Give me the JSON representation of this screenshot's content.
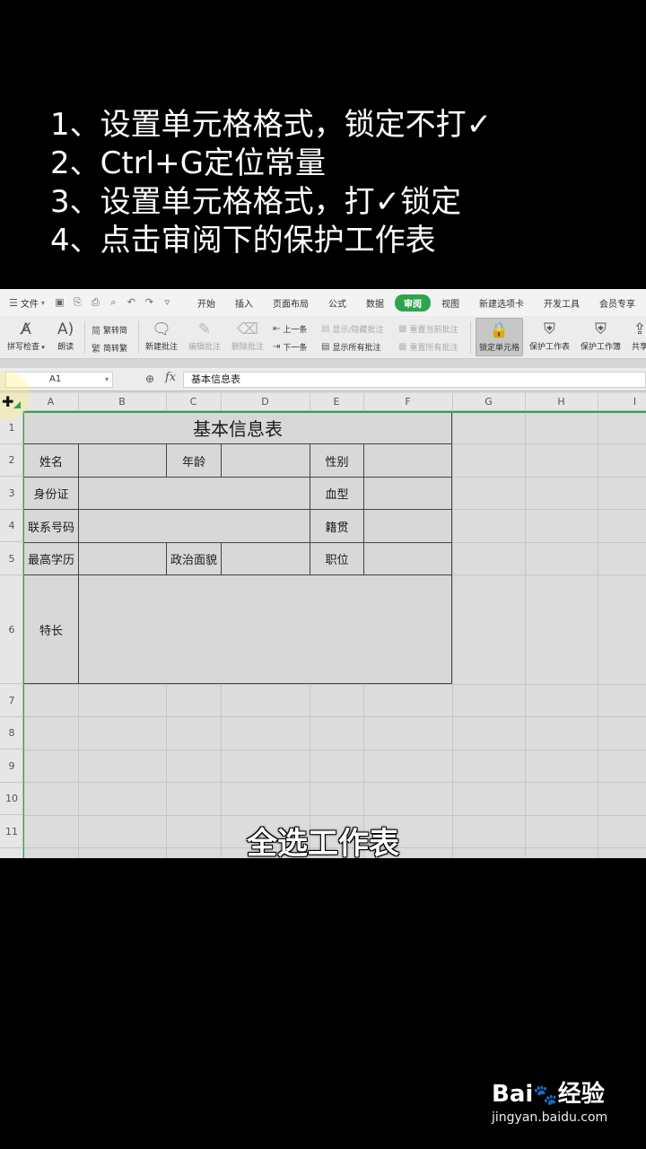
{
  "instructions": [
    "1、设置单元格格式，锁定不打✓",
    "2、Ctrl+G定位常量",
    "3、设置单元格格式，打✓锁定",
    "4、点击审阅下的保护工作表"
  ],
  "menubar": {
    "file_label": "文件",
    "tabs": [
      "开始",
      "插入",
      "页面布局",
      "公式",
      "数据",
      "审阅",
      "视图",
      "新建选项卡",
      "开发工具",
      "会员专享"
    ],
    "active_tab": "审阅"
  },
  "ribbon": {
    "spell_check": "拼写检查",
    "read_aloud": "朗读",
    "trad_to_simp": "繁转简",
    "simp_to_trad": "简转繁",
    "new_comment": "新建批注",
    "edit_comment": "编辑批注",
    "delete_comment": "删除批注",
    "prev_comment": "上一条",
    "next_comment": "下一条",
    "show_hide_comment": "显示/隐藏批注",
    "show_all_comments": "显示所有批注",
    "reset_current_comment": "重置当前批注",
    "reset_all_comments": "重置所有批注",
    "lock_cell": "锁定单元格",
    "protect_sheet": "保护工作表",
    "protect_workbook": "保护工作簿",
    "share": "共享"
  },
  "formula_bar": {
    "name_box": "A1",
    "fx_label": "fx",
    "content": "基本信息表"
  },
  "sheet": {
    "columns": [
      "A",
      "B",
      "C",
      "D",
      "E",
      "F",
      "G",
      "H",
      "I"
    ],
    "rows": [
      "1",
      "2",
      "3",
      "4",
      "5",
      "6",
      "7",
      "8",
      "9",
      "10",
      "11"
    ]
  },
  "table": {
    "title": "基本信息表",
    "name": "姓名",
    "age": "年龄",
    "gender": "性别",
    "id_card": "身份证",
    "blood_type": "血型",
    "phone": "联系号码",
    "native_place": "籍贯",
    "education": "最高学历",
    "politics": "政治面貌",
    "position": "职位",
    "specialty": "特长"
  },
  "caption": "全选工作表",
  "watermark": {
    "logo": "Bai",
    "logo_paw": "🐾",
    "logo_suffix": "经验",
    "site": "jingyan.baidu.com"
  }
}
